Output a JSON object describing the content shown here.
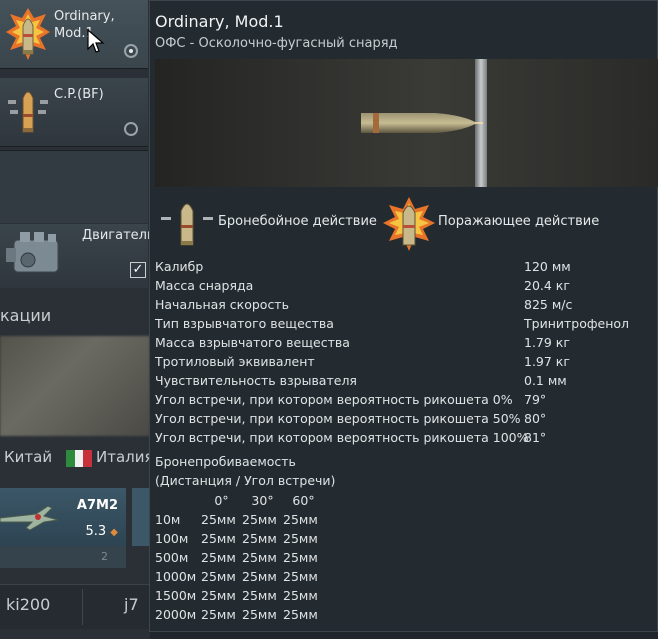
{
  "modules": [
    {
      "label": "Ordinary, Mod.1",
      "selected": true
    },
    {
      "label": "C.P.(BF)",
      "selected": false
    }
  ],
  "engine": {
    "label": "Двигатель",
    "checked": true,
    "check_glyph": "✓"
  },
  "section_title": "кации",
  "nations": [
    {
      "label": "Китай"
    },
    {
      "label": "Италия",
      "flag_colors": [
        "#2e8b3e",
        "#f1f1f1",
        "#c7323a"
      ]
    }
  ],
  "vehicle": {
    "name": "A7M2",
    "br": "5.3",
    "br_glyph": "◆",
    "sub": "2"
  },
  "bottom_tabs": [
    {
      "label": "ki200"
    },
    {
      "label": "j7"
    }
  ],
  "tooltip": {
    "title": "Ordinary, Mod.1",
    "subtitle": "ОФС - Осколочно-фугасный снаряд",
    "effects": [
      {
        "label": "Бронебойное действие",
        "icon": "armor-piercing-shell-icon"
      },
      {
        "label": "Поражающее действие",
        "icon": "high-explosive-shell-icon"
      }
    ],
    "stats": [
      {
        "label": "Калибр",
        "value": "120 мм"
      },
      {
        "label": "Масса снаряда",
        "value": "20.4 кг"
      },
      {
        "label": "Начальная скорость",
        "value": "825 м/с"
      },
      {
        "label": "Тип взрывчатого вещества",
        "value": "Тринитрофенол"
      },
      {
        "label": "Масса взрывчатого вещества",
        "value": "1.79 кг"
      },
      {
        "label": "Тротиловый эквивалент",
        "value": "1.97 кг"
      },
      {
        "label": "Чувствительность взрывателя",
        "value": "0.1 мм"
      },
      {
        "label": "Угол встречи, при котором вероятность рикошета 0%",
        "value": "79°"
      },
      {
        "label": "Угол встречи, при котором вероятность рикошета 50%",
        "value": "80°"
      },
      {
        "label": "Угол встречи, при котором вероятность рикошета 100%",
        "value": "81°"
      }
    ],
    "penetration": {
      "title": "Бронепробиваемость",
      "subtitle": "(Дистанция / Угол встречи)",
      "angles": [
        "0°",
        "30°",
        "60°"
      ],
      "rows": [
        {
          "distance": "10м",
          "values": [
            "25мм",
            "25мм",
            "25мм"
          ]
        },
        {
          "distance": "100м",
          "values": [
            "25мм",
            "25мм",
            "25мм"
          ]
        },
        {
          "distance": "500м",
          "values": [
            "25мм",
            "25мм",
            "25мм"
          ]
        },
        {
          "distance": "1000м",
          "values": [
            "25мм",
            "25мм",
            "25мм"
          ]
        },
        {
          "distance": "1500м",
          "values": [
            "25мм",
            "25мм",
            "25мм"
          ]
        },
        {
          "distance": "2000м",
          "values": [
            "25мм",
            "25мм",
            "25мм"
          ]
        }
      ]
    }
  }
}
